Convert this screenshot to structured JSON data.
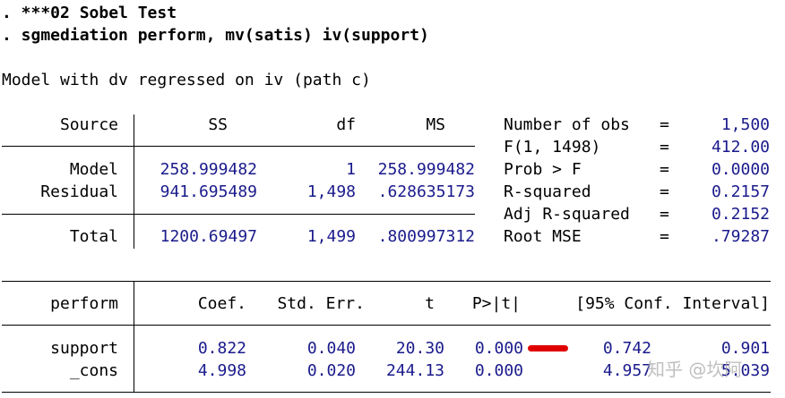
{
  "colors": {
    "value_text": "#1a1a8c",
    "marker": "#e00000"
  },
  "commands": [
    ". ***02 Sobel Test",
    ". sgmediation perform, mv(satis) iv(support)"
  ],
  "model_title": "Model with dv regressed on iv (path c)",
  "anova": {
    "headers": {
      "source": "Source",
      "ss": "SS",
      "df": "df",
      "ms": "MS"
    },
    "rows": [
      {
        "source": "Model",
        "ss": "258.999482",
        "df": "1",
        "ms": "258.999482"
      },
      {
        "source": "Residual",
        "ss": "941.695489",
        "df": "1,498",
        "ms": ".628635173"
      }
    ],
    "total": {
      "source": "Total",
      "ss": "1200.69497",
      "df": "1,499",
      "ms": ".800997312"
    }
  },
  "stats": [
    {
      "label": "Number of obs",
      "eq": "=",
      "value": "1,500"
    },
    {
      "label": "F(1, 1498)",
      "eq": "=",
      "value": "412.00"
    },
    {
      "label": "Prob > F",
      "eq": "=",
      "value": "0.0000"
    },
    {
      "label": "R-squared",
      "eq": "=",
      "value": "0.2157"
    },
    {
      "label": "Adj R-squared",
      "eq": "=",
      "value": "0.2152"
    },
    {
      "label": "Root MSE",
      "eq": "=",
      "value": ".79287"
    }
  ],
  "coef": {
    "headers": {
      "depvar": "perform",
      "coef": "Coef.",
      "se": "Std. Err.",
      "t": "t",
      "p": "P>|t|",
      "ci": "[95% Conf. Interval]"
    },
    "rows": [
      {
        "var": "support",
        "coef": "0.822",
        "se": "0.040",
        "t": "20.30",
        "p": "0.000",
        "lo": "0.742",
        "hi": "0.901"
      },
      {
        "var": "_cons",
        "coef": "4.998",
        "se": "0.020",
        "t": "244.13",
        "p": "0.000",
        "lo": "4.957",
        "hi": "5.039"
      }
    ]
  },
  "watermark": "知乎 @坎阿"
}
